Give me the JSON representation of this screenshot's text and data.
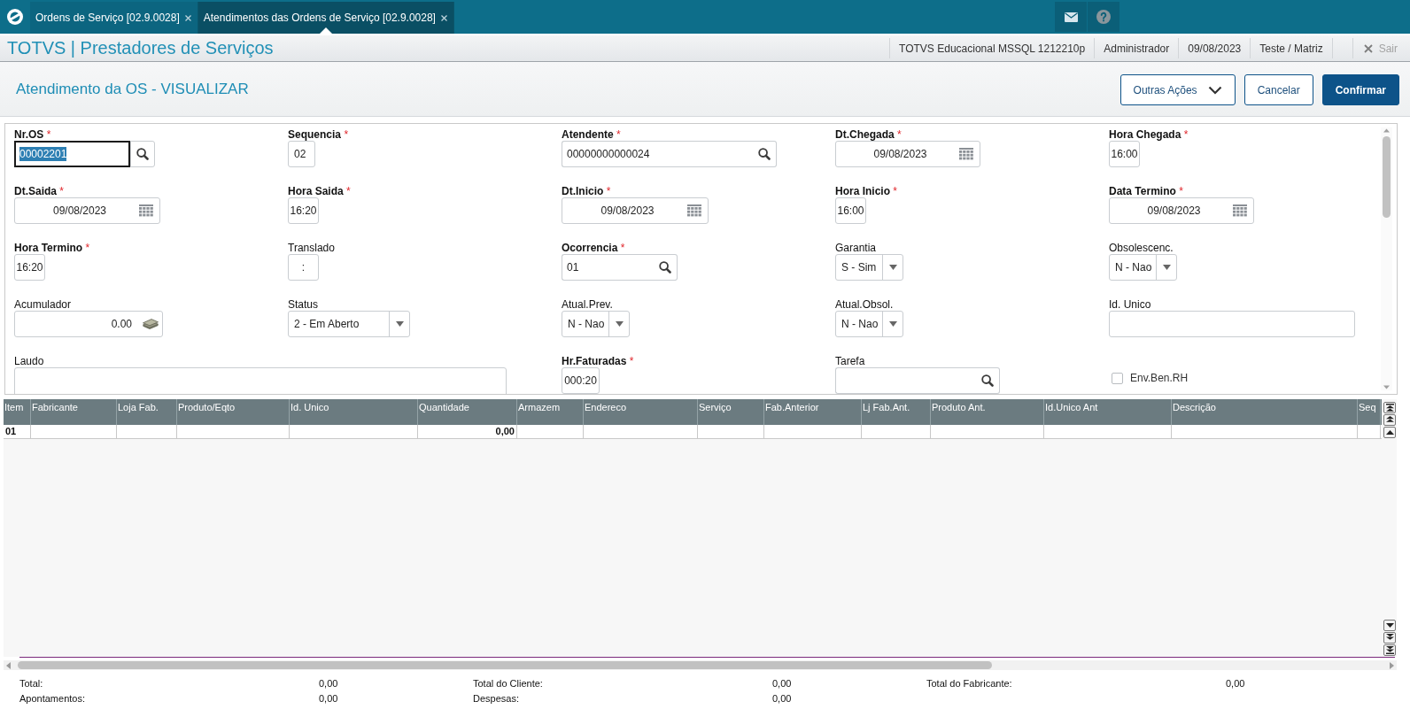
{
  "tabs": [
    {
      "label": "Ordens de Serviço [02.9.0028]",
      "selected": false
    },
    {
      "label": "Atendimentos das Ordens de Serviço [02.9.0028]",
      "selected": true
    }
  ],
  "app_header": {
    "title": "TOTVS | Prestadores de Serviços",
    "info": [
      "TOTVS Educacional MSSQL 1212210p",
      "Administrador",
      "09/08/2023",
      "Teste / Matriz"
    ],
    "exit": {
      "label": "Sair",
      "disabled": true
    }
  },
  "page_header": {
    "title": "Atendimento da OS - VISUALIZAR",
    "actions": [
      {
        "label": "Outras Ações",
        "kind": "menu"
      },
      {
        "label": "Cancelar",
        "kind": "secondary"
      },
      {
        "label": "Confirmar",
        "kind": "primary"
      }
    ]
  },
  "form": {
    "fields": [
      {
        "label": "Nr.OS",
        "required_mark": "*",
        "kind": "lookup",
        "value": "00002201",
        "focused": true
      },
      {
        "label": "Sequencia",
        "required_mark": "*",
        "kind": "text",
        "value": "02",
        "focused": false
      },
      {
        "label": "Atendente",
        "required_mark": "*",
        "kind": "lookup",
        "value": "00000000000024",
        "focused": false
      },
      {
        "label": "Dt.Chegada",
        "required_mark": "*",
        "kind": "date",
        "value": "09/08/2023",
        "focused": false
      },
      {
        "label": "Hora Chegada",
        "required_mark": "*",
        "kind": "time",
        "value": "16:00",
        "focused": false
      },
      {
        "label": "Dt.Saida",
        "required_mark": "*",
        "kind": "date",
        "value": "09/08/2023",
        "focused": false
      },
      {
        "label": "Hora Saida",
        "required_mark": "*",
        "kind": "time",
        "value": "16:20",
        "focused": false
      },
      {
        "label": "Dt.Inicio",
        "required_mark": "*",
        "kind": "date",
        "value": "09/08/2023",
        "focused": false
      },
      {
        "label": "Hora Inicio",
        "required_mark": "*",
        "kind": "time",
        "value": "16:00",
        "focused": false
      },
      {
        "label": "Data Termino",
        "required_mark": "*",
        "kind": "date",
        "value": "09/08/2023",
        "focused": false
      },
      {
        "label": "Hora Termino",
        "required_mark": "*",
        "kind": "time",
        "value": "16:20",
        "focused": false
      },
      {
        "label": "Translado",
        "kind": "time",
        "value": ":",
        "focused": false
      },
      {
        "label": "Ocorrencia",
        "required_mark": "*",
        "kind": "lookup",
        "value": "01",
        "focused": false
      },
      {
        "label": "Garantia",
        "kind": "select",
        "value": "S - Sim",
        "focused": false
      },
      {
        "label": "Obsolescenc.",
        "kind": "select",
        "value": "N - Nao",
        "focused": false
      },
      {
        "label": "Acumulador",
        "kind": "money",
        "value": "0.00",
        "focused": false
      },
      {
        "label": "Status",
        "kind": "select",
        "value": "2 - Em Aberto",
        "focused": false
      },
      {
        "label": "Atual.Prev.",
        "kind": "select",
        "value": "N - Nao",
        "focused": false
      },
      {
        "label": "Atual.Obsol.",
        "kind": "select",
        "value": "N - Nao",
        "focused": false
      },
      {
        "label": "Id. Unico",
        "kind": "text",
        "focused": false
      },
      {
        "label": "Laudo",
        "kind": "memo",
        "focused": false
      },
      {
        "label": "Hr.Faturadas",
        "required_mark": "*",
        "kind": "time",
        "value": "000:20",
        "focused": false
      },
      {
        "label": "Tarefa",
        "kind": "lookup",
        "focused": false
      },
      {
        "label": "Env.Ben.RH",
        "kind": "checkbox",
        "checked": false,
        "focused": false
      }
    ]
  },
  "grid": {
    "columns": [
      "Item",
      "Fabricante",
      "Loja Fab.",
      "Produto/Eqto",
      "Id. Unico",
      "Quantidade",
      "Armazem",
      "Endereco",
      "Serviço",
      "Fab.Anterior",
      "Lj Fab.Ant.",
      "Produto Ant.",
      "Id.Unico Ant",
      "Descrição",
      "Seq"
    ],
    "rows": [
      {
        "cells": [
          "01",
          null,
          null,
          null,
          null,
          "0,00",
          null,
          null,
          null,
          null,
          null,
          null,
          null,
          null,
          null
        ]
      }
    ]
  },
  "totals": {
    "rows": [
      {
        "items": [
          {
            "label": "Total:",
            "value": "0,00"
          },
          {
            "label": "Total do Cliente:",
            "value": "0,00"
          },
          {
            "label": "Total do Fabricante:",
            "value": "0,00"
          }
        ]
      },
      {
        "items": [
          {
            "label": "Apontamentos:",
            "value": "0,00"
          },
          {
            "label": "Despesas:",
            "value": "0,00"
          }
        ]
      }
    ]
  }
}
